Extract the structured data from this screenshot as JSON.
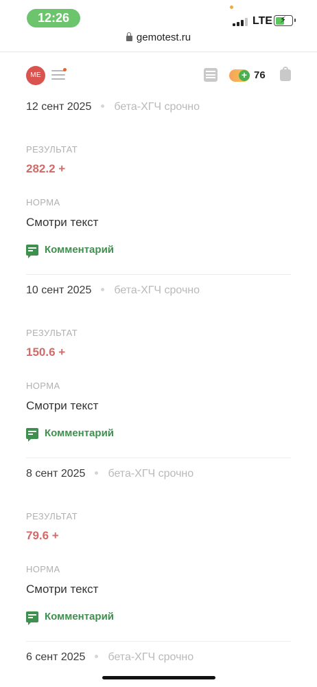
{
  "status_bar": {
    "time": "12:26",
    "network": "LTE",
    "accent_color": "#6cc46c"
  },
  "browser": {
    "url": "gemotest.ru"
  },
  "header": {
    "avatar_initials": "МЕ",
    "bonus_count": "76"
  },
  "entries": [
    {
      "date": "12 сент 2025",
      "test": "бета-ХГЧ срочно",
      "result_label": "РЕЗУЛЬТАТ",
      "result": "282.2 +",
      "norm_label": "НОРМА",
      "norm": "Смотри текст",
      "comment_label": "Комментарий"
    },
    {
      "date": "10 сент 2025",
      "test": "бета-ХГЧ срочно",
      "result_label": "РЕЗУЛЬТАТ",
      "result": "150.6 +",
      "norm_label": "НОРМА",
      "norm": "Смотри текст",
      "comment_label": "Комментарий"
    },
    {
      "date": "8 сент 2025",
      "test": "бета-ХГЧ срочно",
      "result_label": "РЕЗУЛЬТАТ",
      "result": "79.6 +",
      "norm_label": "НОРМА",
      "norm": "Смотри текст",
      "comment_label": "Комментарий"
    },
    {
      "date": "6 сент 2025",
      "test": "бета-ХГЧ срочно"
    }
  ],
  "colors": {
    "result_positive": "#cf6b68",
    "comment_green": "#3f8f4f",
    "avatar_red": "#d9534f"
  }
}
